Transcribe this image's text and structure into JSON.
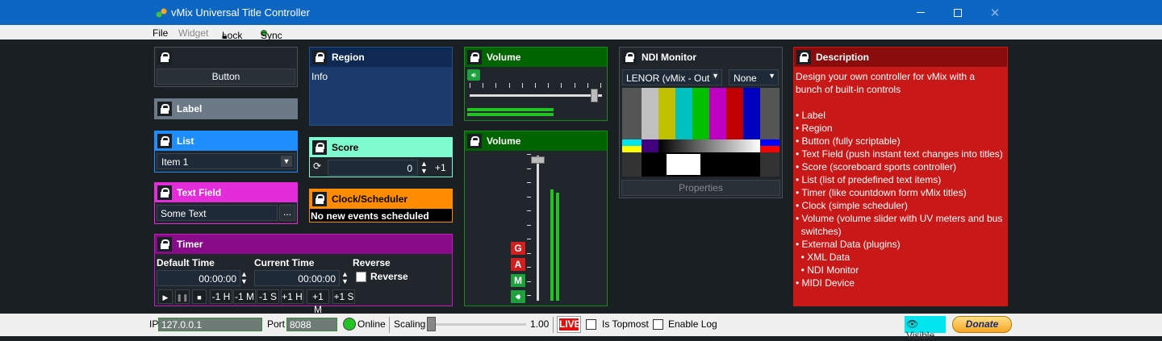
{
  "window": {
    "title": "vMix Universal Title Controller",
    "min_icon": "minimize-icon",
    "max_icon": "maximize-icon",
    "close_icon": "close-icon"
  },
  "menu": {
    "file": "File",
    "widget": "Widget",
    "lock": "Lock",
    "sync": "Sync",
    "sync_color": "#22c322"
  },
  "button_widget": {
    "label": "Button"
  },
  "label_widget": {
    "title": "Label",
    "color": "#6c7a88"
  },
  "list_widget": {
    "title": "List",
    "selected": "Item 1",
    "color": "#1e8eff"
  },
  "textfield_widget": {
    "title": "Text Field",
    "value": "Some Text",
    "browse": "...",
    "color": "#e52cdb"
  },
  "timer_widget": {
    "title": "Timer",
    "default_time_label": "Default Time",
    "current_time_label": "Current Time",
    "reverse_label": "Reverse",
    "reverse_check": "Reverse",
    "default_time": "00:00:00",
    "current_time": "00:00:00",
    "buttons": [
      "-1 H",
      "-1 M",
      "-1 S",
      "+1 H",
      "+1 M",
      "+1 S"
    ],
    "color": "#8a0b8a"
  },
  "region_widget": {
    "title": "Region",
    "content": "Info",
    "color": "#1a3b6c"
  },
  "score_widget": {
    "title": "Score",
    "value": "0",
    "plus": "+1",
    "color": "#7ffccf"
  },
  "clock_widget": {
    "title": "Clock/Scheduler",
    "status": "No new events scheduled",
    "color": "#ff8c00"
  },
  "volume_h": {
    "title": "Volume",
    "level": 0.97,
    "color": "#006400"
  },
  "volume_v": {
    "title": "Volume",
    "level": 0.98,
    "buses": [
      "G",
      "A",
      "M"
    ],
    "bus_color_red": "#d21e1e",
    "bus_color_green": "#1ea03c"
  },
  "ndi_widget": {
    "title": "NDI Monitor",
    "source": "LENOR (vMix - Out",
    "audio": "None",
    "properties": "Properties"
  },
  "description_widget": {
    "title": "Description",
    "color": "#c81818",
    "lines": [
      "Design your own controller for vMix with a",
      "bunch of built-in controls",
      "",
      "• Label",
      "• Region",
      "• Button (fully scriptable)",
      "• Text Field (push instant text changes into titles)",
      "• Score (scoreboard sports controller)",
      "• List (list of predefined text items)",
      "• Timer (like countdown form vMix titles)",
      "• Clock (simple scheduler)",
      "• Volume (volume slider with UV meters and bus",
      "  switches)",
      "• External Data (plugins)",
      "  • XML Data",
      "  • NDI Monitor",
      "• MIDI Device"
    ]
  },
  "status": {
    "ip_label": "IP",
    "ip": "127.0.0.1",
    "port_label": "Port",
    "port": "8088",
    "online": "Online",
    "scaling_label": "Scaling",
    "scaling": "1.00",
    "scaling_level": 0.0,
    "live": "LIVE",
    "topmost": "Is Topmost",
    "enable_log": "Enable Log",
    "visible": "Visible",
    "donate": "Donate"
  }
}
